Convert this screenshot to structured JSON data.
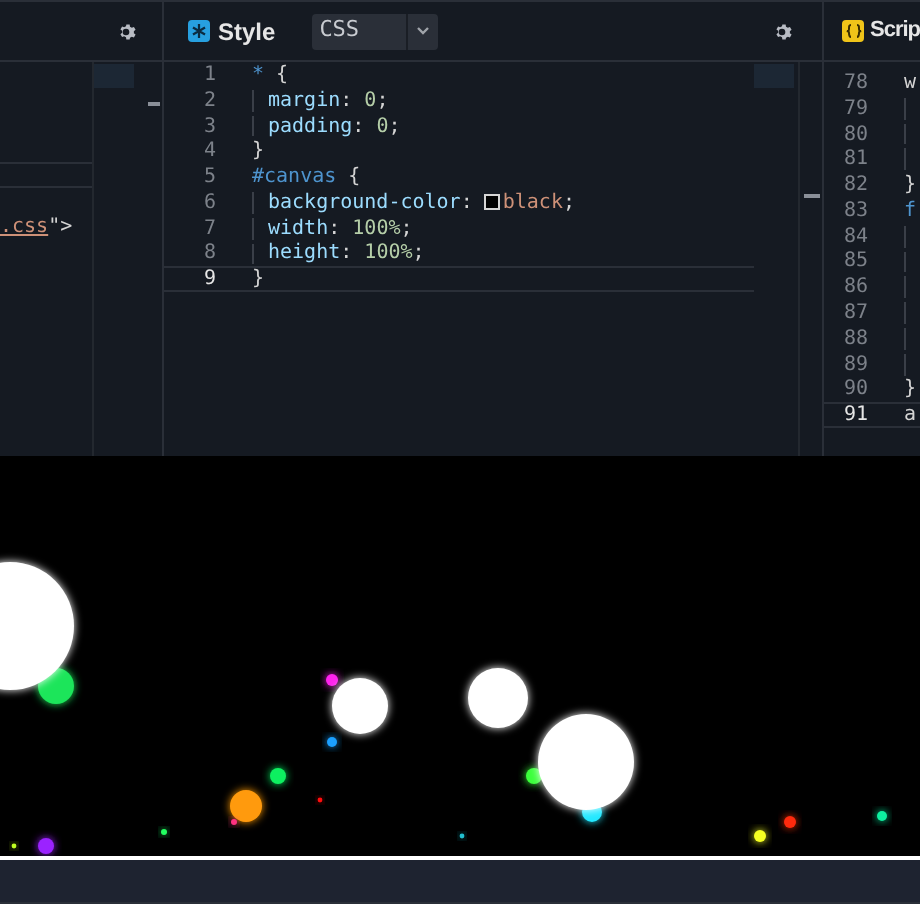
{
  "panes": [
    {
      "kind": "html",
      "lines": [
        {
          "tokens": [
            {
              "text": ".css",
              "kind": "string-link"
            },
            {
              "text": "\">",
              "kind": "punct"
            }
          ]
        }
      ]
    },
    {
      "kind": "css",
      "title": "Style",
      "language": "CSS",
      "lines": [
        {
          "number": "1",
          "current": false,
          "indent": false,
          "tokens": [
            {
              "text": "*",
              "kind": "selector"
            },
            {
              "text": " {",
              "kind": "punct"
            }
          ]
        },
        {
          "number": "2",
          "current": false,
          "indent": true,
          "tokens": [
            {
              "text": "margin",
              "kind": "property"
            },
            {
              "text": ": ",
              "kind": "punct"
            },
            {
              "text": "0",
              "kind": "number"
            },
            {
              "text": ";",
              "kind": "punct"
            }
          ]
        },
        {
          "number": "3",
          "current": false,
          "indent": true,
          "tokens": [
            {
              "text": "padding",
              "kind": "property"
            },
            {
              "text": ": ",
              "kind": "punct"
            },
            {
              "text": "0",
              "kind": "number"
            },
            {
              "text": ";",
              "kind": "punct"
            }
          ]
        },
        {
          "number": "4",
          "current": false,
          "indent": false,
          "tokens": [
            {
              "text": "}",
              "kind": "punct"
            }
          ]
        },
        {
          "number": "5",
          "current": false,
          "indent": false,
          "tokens": [
            {
              "text": "#canvas",
              "kind": "selector"
            },
            {
              "text": " {",
              "kind": "punct"
            }
          ]
        },
        {
          "number": "6",
          "current": false,
          "indent": true,
          "tokens": [
            {
              "text": "background-color",
              "kind": "property"
            },
            {
              "text": ": ",
              "kind": "punct"
            },
            {
              "text": "black",
              "kind": "color"
            },
            {
              "text": ";",
              "kind": "punct"
            }
          ]
        },
        {
          "number": "7",
          "current": false,
          "indent": true,
          "tokens": [
            {
              "text": "width",
              "kind": "property"
            },
            {
              "text": ": ",
              "kind": "punct"
            },
            {
              "text": "100%",
              "kind": "number"
            },
            {
              "text": ";",
              "kind": "punct"
            }
          ]
        },
        {
          "number": "8",
          "current": false,
          "indent": true,
          "tokens": [
            {
              "text": "height",
              "kind": "property"
            },
            {
              "text": ": ",
              "kind": "punct"
            },
            {
              "text": "100%",
              "kind": "number"
            },
            {
              "text": ";",
              "kind": "punct"
            }
          ]
        },
        {
          "number": "9",
          "current": true,
          "indent": false,
          "tokens": [
            {
              "text": "}",
              "kind": "punct"
            }
          ]
        }
      ]
    },
    {
      "kind": "js",
      "title": "Scrip",
      "lines": [
        {
          "number": "78",
          "current": false,
          "indent": false,
          "tokens": [
            {
              "text": "w",
              "kind": "plain"
            }
          ]
        },
        {
          "number": "79",
          "current": false,
          "indent": true
        },
        {
          "number": "80",
          "current": false,
          "indent": true
        },
        {
          "number": "81",
          "current": false,
          "indent": true
        },
        {
          "number": "82",
          "current": false,
          "indent": false,
          "tokens": [
            {
              "text": "}",
              "kind": "punct"
            }
          ]
        },
        {
          "number": "83",
          "current": false,
          "indent": false,
          "tokens": [
            {
              "text": "f",
              "kind": "selector"
            }
          ]
        },
        {
          "number": "84",
          "current": false,
          "indent": true
        },
        {
          "number": "85",
          "current": false,
          "indent": true
        },
        {
          "number": "86",
          "current": false,
          "indent": true
        },
        {
          "number": "87",
          "current": false,
          "indent": true
        },
        {
          "number": "88",
          "current": false,
          "indent": true
        },
        {
          "number": "89",
          "current": false,
          "indent": true
        },
        {
          "number": "90",
          "current": false,
          "indent": false,
          "tokens": [
            {
              "text": "}",
              "kind": "punct"
            }
          ]
        },
        {
          "number": "91",
          "current": true,
          "indent": false,
          "tokens": [
            {
              "text": "a",
              "kind": "plain"
            }
          ]
        }
      ]
    }
  ]
}
